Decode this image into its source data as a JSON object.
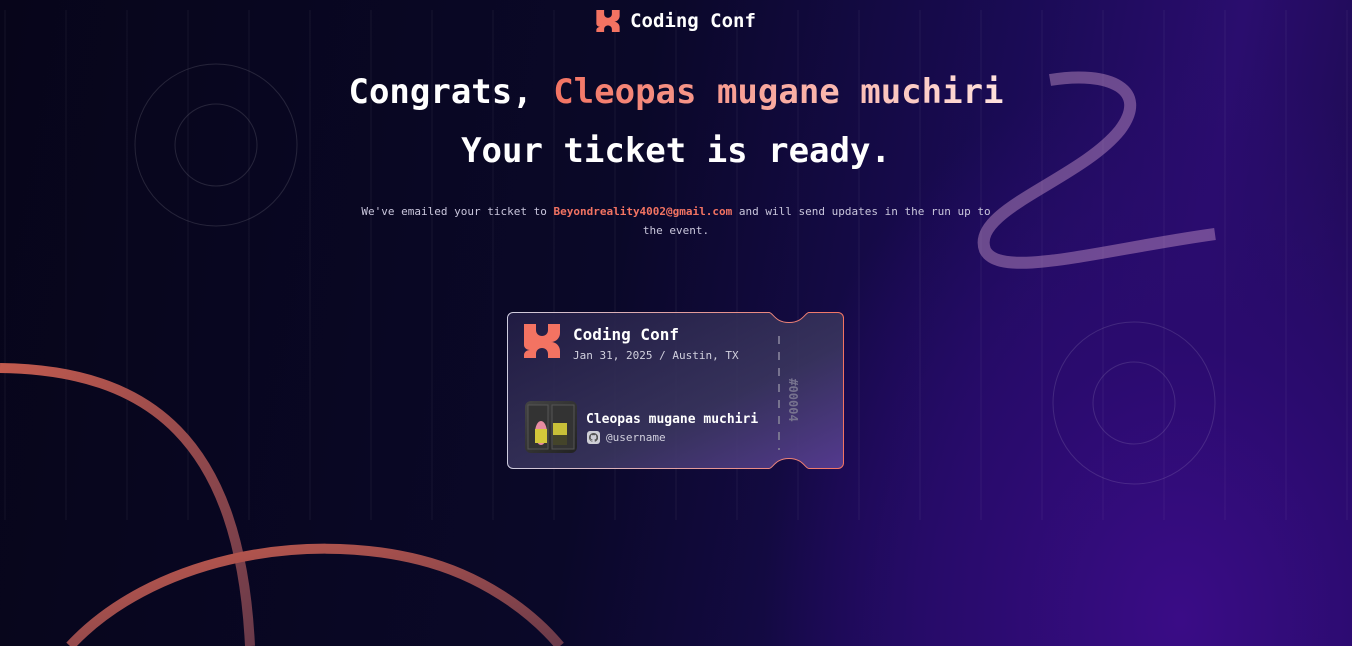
{
  "header": {
    "brand": "Coding Conf",
    "logo_icon": "coding-conf-logo"
  },
  "hero": {
    "congrats": "Congrats,",
    "name": "Cleopas mugane muchiri",
    "subtitle": "Your ticket is ready."
  },
  "message": {
    "before": "We've emailed your ticket to",
    "email": "Beyondreality4002@gmail.com",
    "after": "and will send updates in the run up to the event."
  },
  "ticket": {
    "title": "Coding Conf",
    "date_location": "Jan 31, 2025 / Austin, TX",
    "attendee_name": "Cleopas mugane muchiri",
    "github_username": "@username",
    "ticket_number": "#00004",
    "github_icon": "github-icon"
  },
  "colors": {
    "accent": "#F37362",
    "background": "#0A0828",
    "purple": "#3A0C86"
  }
}
